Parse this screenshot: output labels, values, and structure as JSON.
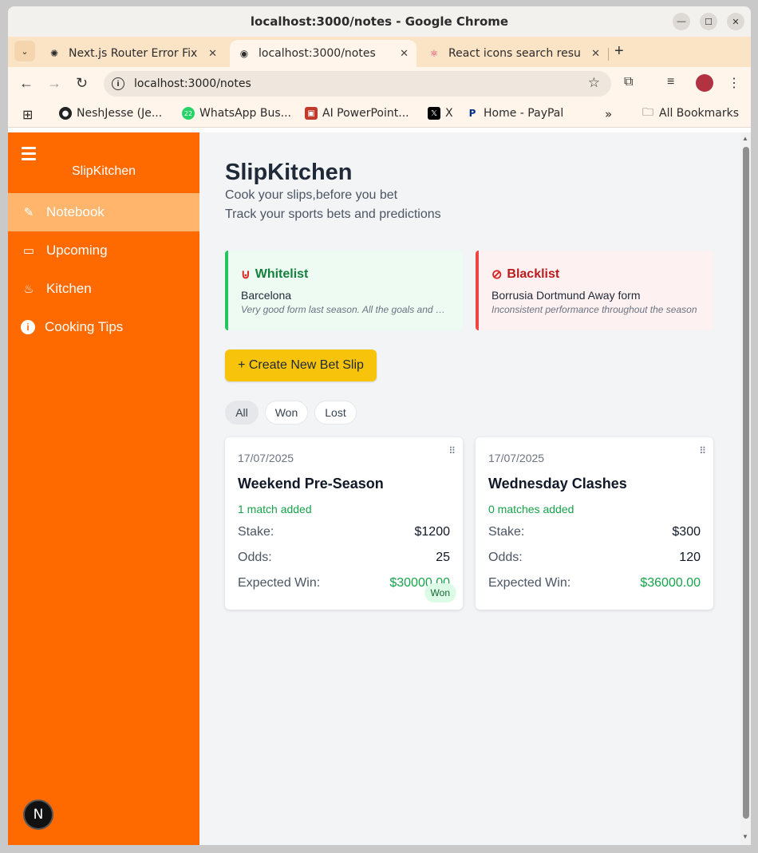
{
  "window": {
    "title": "localhost:3000/notes - Google Chrome"
  },
  "tabs": [
    {
      "label": "Next.js Router Error Fix",
      "icon": "openai-icon"
    },
    {
      "label": "localhost:3000/notes",
      "icon": "kitchen-favicon"
    },
    {
      "label": "React icons search results",
      "icon": "react-icon"
    }
  ],
  "address_bar": {
    "url": "localhost:3000/notes"
  },
  "bookmarks": [
    {
      "label": "NeshJesse (Je...",
      "icon": "github-icon"
    },
    {
      "label": "WhatsApp Bus...",
      "icon": "whatsapp-icon",
      "badge": "22"
    },
    {
      "label": "AI PowerPoint...",
      "icon": "powerpoint-icon"
    },
    {
      "label": "X",
      "icon": "x-icon"
    },
    {
      "label": "Home - PayPal",
      "icon": "paypal-icon"
    }
  ],
  "bookmarks_overflow": "»",
  "all_bookmarks": "All Bookmarks",
  "sidebar": {
    "brand": "SlipKitchen",
    "items": [
      {
        "label": "Notebook",
        "icon": "notebook-icon",
        "active": true
      },
      {
        "label": "Upcoming",
        "icon": "ticket-icon",
        "active": false
      },
      {
        "label": "Kitchen",
        "icon": "chef-icon",
        "active": false
      },
      {
        "label": "Cooking Tips",
        "icon": "info-icon",
        "active": false
      }
    ],
    "next_badge": "N"
  },
  "main": {
    "title": "SlipKitchen",
    "subtitle1": "Cook your slips,before you bet",
    "subtitle2": "Track your sports bets and predictions",
    "whitelist": {
      "heading": "Whitelist",
      "icon": "magnet-icon",
      "team": "Barcelona",
      "note": "Very good form last season. All the goals and assists"
    },
    "blacklist": {
      "heading": "Blacklist",
      "icon": "prohibited-icon",
      "team": "Borrusia Dortmund Away form",
      "note": "Inconsistent performance throughout the season"
    },
    "create_button": "+ Create New Bet Slip",
    "filters": [
      "All",
      "Won",
      "Lost"
    ],
    "active_filter": "All",
    "slips": [
      {
        "date": "17/07/2025",
        "title": "Weekend Pre-Season",
        "matches": "1 match added",
        "stake_label": "Stake:",
        "stake": "$1200",
        "odds_label": "Odds:",
        "odds": "25",
        "win_label": "Expected Win:",
        "win": "$30000.00",
        "status": "Won"
      },
      {
        "date": "17/07/2025",
        "title": "Wednesday Clashes",
        "matches": "0 matches added",
        "stake_label": "Stake:",
        "stake": "$300",
        "odds_label": "Odds:",
        "odds": "120",
        "win_label": "Expected Win:",
        "win": "$36000.00",
        "status": ""
      }
    ]
  },
  "colors": {
    "sidebar": "#ff6a00",
    "sidebar_active": "#ffb56b",
    "create_button": "#f8c30b",
    "whitelist_accent": "#22c55e",
    "blacklist_accent": "#ef4444",
    "won_green": "#16a34a"
  }
}
